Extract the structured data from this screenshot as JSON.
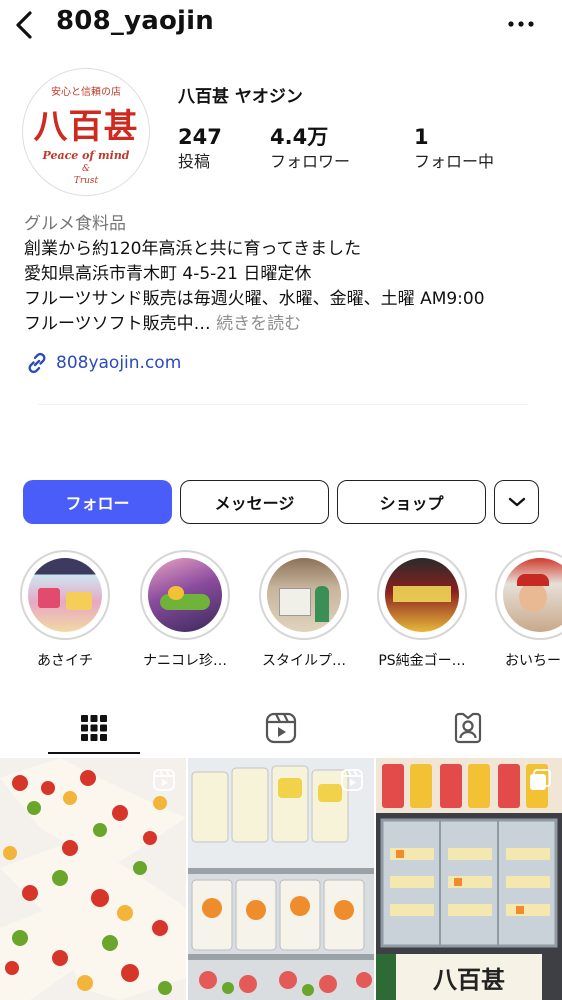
{
  "header": {
    "username": "808_yaojin"
  },
  "profile": {
    "avatar_logo": {
      "tagline": "安心と信頼の店",
      "name": "八百甚",
      "line1": "Peace of mind",
      "line2": "&",
      "line3": "Trust"
    },
    "display_name": "八百甚 ヤオジン",
    "stats": [
      {
        "value": "247",
        "label": "投稿"
      },
      {
        "value": "4.4万",
        "label": "フォロワー"
      },
      {
        "value": "1",
        "label": "フォロー中"
      }
    ]
  },
  "bio": {
    "category": "グルメ食料品",
    "lines": [
      "創業から約120年高浜と共に育ってきました",
      "愛知県高浜市青木町 4-5-21 日曜定休",
      "フルーツサンド販売は毎週火曜、水曜、金曜、土曜 AM9:00"
    ],
    "last_line": "フルーツソフト販売中…",
    "more_label": "続きを読む",
    "link": "808yaojin.com"
  },
  "actions": {
    "follow": "フォロー",
    "message": "メッセージ",
    "shop": "ショップ"
  },
  "highlights": [
    {
      "label": "あさイチ"
    },
    {
      "label": "ナニコレ珍…"
    },
    {
      "label": "スタイルプ…"
    },
    {
      "label": "PS純金ゴー…"
    },
    {
      "label": "おいちーっ"
    }
  ],
  "tabs": [
    {
      "icon": "grid-icon"
    },
    {
      "icon": "reels-icon"
    },
    {
      "icon": "tagged-icon"
    }
  ],
  "colors": {
    "primary": "#4a5df9",
    "link": "#2b4bbd",
    "brand_red": "#cf2a1f"
  }
}
